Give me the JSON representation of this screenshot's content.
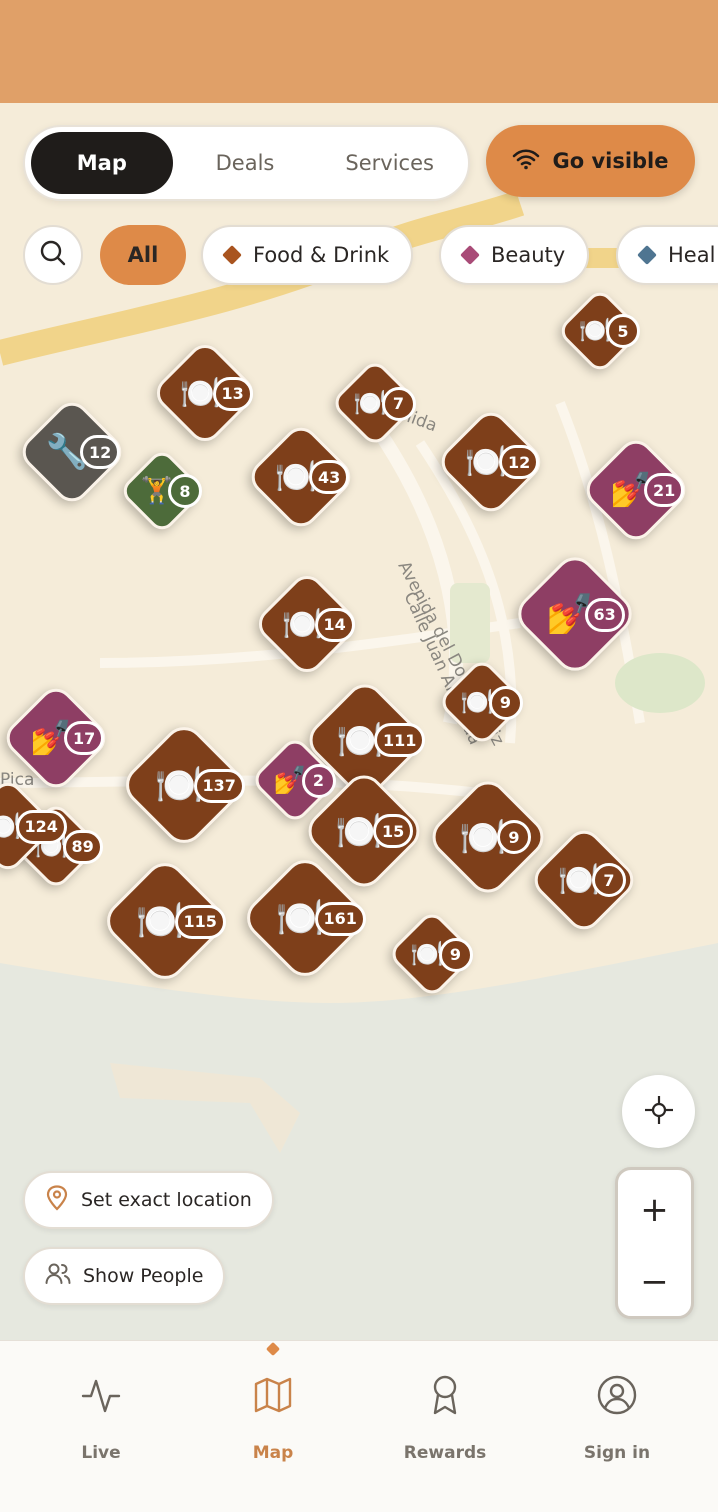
{
  "header": {
    "color": "#e0a068"
  },
  "view_switch": {
    "map": "Map",
    "deals": "Deals",
    "services": "Services"
  },
  "go_visible": {
    "label": "Go visible",
    "icon": "wifi-icon"
  },
  "filters": {
    "search_icon": "search-icon",
    "all": "All",
    "food_drink": "Food & Drink",
    "beauty": "Beauty",
    "health": "Heal"
  },
  "colors": {
    "food": "#7e3f1a",
    "beauty": "#8e3e64",
    "health": "#4f7591",
    "services": "#5a5650",
    "fitness": "#4d6b3a",
    "accent": "#de8a48"
  },
  "map_labels": {
    "street_1": "Avenida del Doctor Maiz",
    "street_2": "Calle Juan Alameda",
    "street_3": "nida",
    "street_4": "Pica"
  },
  "markers": [
    {
      "category": "food",
      "count": "13"
    },
    {
      "category": "food",
      "count": "7"
    },
    {
      "category": "food",
      "count": "5"
    },
    {
      "category": "services",
      "count": "12"
    },
    {
      "category": "fitness",
      "count": "8"
    },
    {
      "category": "food",
      "count": "43"
    },
    {
      "category": "food",
      "count": "12"
    },
    {
      "category": "beauty",
      "count": "21"
    },
    {
      "category": "beauty",
      "count": "63"
    },
    {
      "category": "food",
      "count": "14"
    },
    {
      "category": "food",
      "count": "9"
    },
    {
      "category": "beauty",
      "count": "17"
    },
    {
      "category": "food",
      "count": "111"
    },
    {
      "category": "food",
      "count": "137"
    },
    {
      "category": "beauty",
      "count": "2"
    },
    {
      "category": "food",
      "count": "9"
    },
    {
      "category": "food",
      "count": "89"
    },
    {
      "category": "food",
      "count": "7"
    },
    {
      "category": "food",
      "count": "15"
    },
    {
      "category": "food",
      "count": "115"
    },
    {
      "category": "food",
      "count": "161"
    },
    {
      "category": "food",
      "count": "9"
    },
    {
      "category": "food",
      "count": "124"
    }
  ],
  "map_controls": {
    "locate_icon": "crosshair-icon",
    "zoom_in": "+",
    "zoom_out": "−"
  },
  "location": {
    "set_exact": "Set exact location",
    "show_people": "Show People"
  },
  "nav": {
    "live": "Live",
    "map": "Map",
    "rewards": "Rewards",
    "sign_in": "Sign in"
  }
}
